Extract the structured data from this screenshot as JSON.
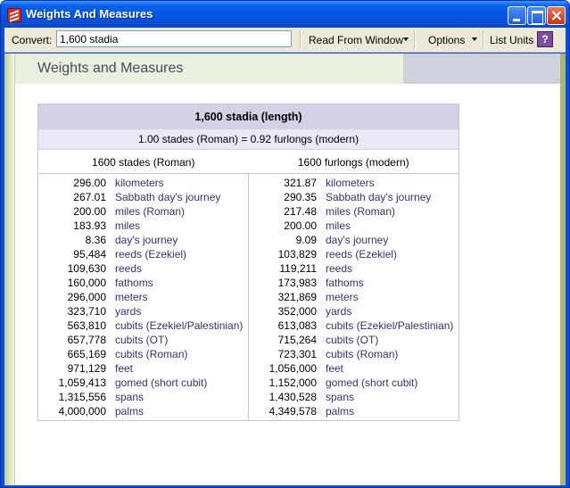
{
  "window": {
    "title": "Weights And Measures"
  },
  "toolbar": {
    "convert_label": "Convert:",
    "convert_value": "1,600 stadia",
    "read_from_window": "Read From Window",
    "options": "Options",
    "list_units": "List Units",
    "help_glyph": "?"
  },
  "page": {
    "title": "Weights and Measures"
  },
  "table": {
    "header": "1,600 stadia (length)",
    "equivalence": "1.00 stades (Roman) = 0.92 furlongs (modern)",
    "left_heading": "1600 stades (Roman)",
    "right_heading": "1600 furlongs (modern)",
    "left_rows": [
      {
        "value": "296.00",
        "unit": "kilometers"
      },
      {
        "value": "267.01",
        "unit": "Sabbath day's journey"
      },
      {
        "value": "200.00",
        "unit": "miles (Roman)"
      },
      {
        "value": "183.93",
        "unit": "miles"
      },
      {
        "value": "8.36",
        "unit": "day's journey"
      },
      {
        "value": "95,484",
        "unit": "reeds (Ezekiel)"
      },
      {
        "value": "109,630",
        "unit": "reeds"
      },
      {
        "value": "160,000",
        "unit": "fathoms"
      },
      {
        "value": "296,000",
        "unit": "meters"
      },
      {
        "value": "323,710",
        "unit": "yards"
      },
      {
        "value": "563,810",
        "unit": "cubits (Ezekiel/Palestinian)"
      },
      {
        "value": "657,778",
        "unit": "cubits (OT)"
      },
      {
        "value": "665,169",
        "unit": "cubits (Roman)"
      },
      {
        "value": "971,129",
        "unit": "feet"
      },
      {
        "value": "1,059,413",
        "unit": "gomed (short cubit)"
      },
      {
        "value": "1,315,556",
        "unit": "spans"
      },
      {
        "value": "4,000,000",
        "unit": "palms"
      }
    ],
    "right_rows": [
      {
        "value": "321.87",
        "unit": "kilometers"
      },
      {
        "value": "290.35",
        "unit": "Sabbath day's journey"
      },
      {
        "value": "217.48",
        "unit": "miles (Roman)"
      },
      {
        "value": "200.00",
        "unit": "miles"
      },
      {
        "value": "9.09",
        "unit": "day's journey"
      },
      {
        "value": "103,829",
        "unit": "reeds (Ezekiel)"
      },
      {
        "value": "119,211",
        "unit": "reeds"
      },
      {
        "value": "173,983",
        "unit": "fathoms"
      },
      {
        "value": "321,869",
        "unit": "meters"
      },
      {
        "value": "352,000",
        "unit": "yards"
      },
      {
        "value": "613,083",
        "unit": "cubits (Ezekiel/Palestinian)"
      },
      {
        "value": "715,264",
        "unit": "cubits (OT)"
      },
      {
        "value": "723,301",
        "unit": "cubits (Roman)"
      },
      {
        "value": "1,056,000",
        "unit": "feet"
      },
      {
        "value": "1,152,000",
        "unit": "gomed (short cubit)"
      },
      {
        "value": "1,430,528",
        "unit": "spans"
      },
      {
        "value": "4,349,578",
        "unit": "palms"
      }
    ]
  }
}
